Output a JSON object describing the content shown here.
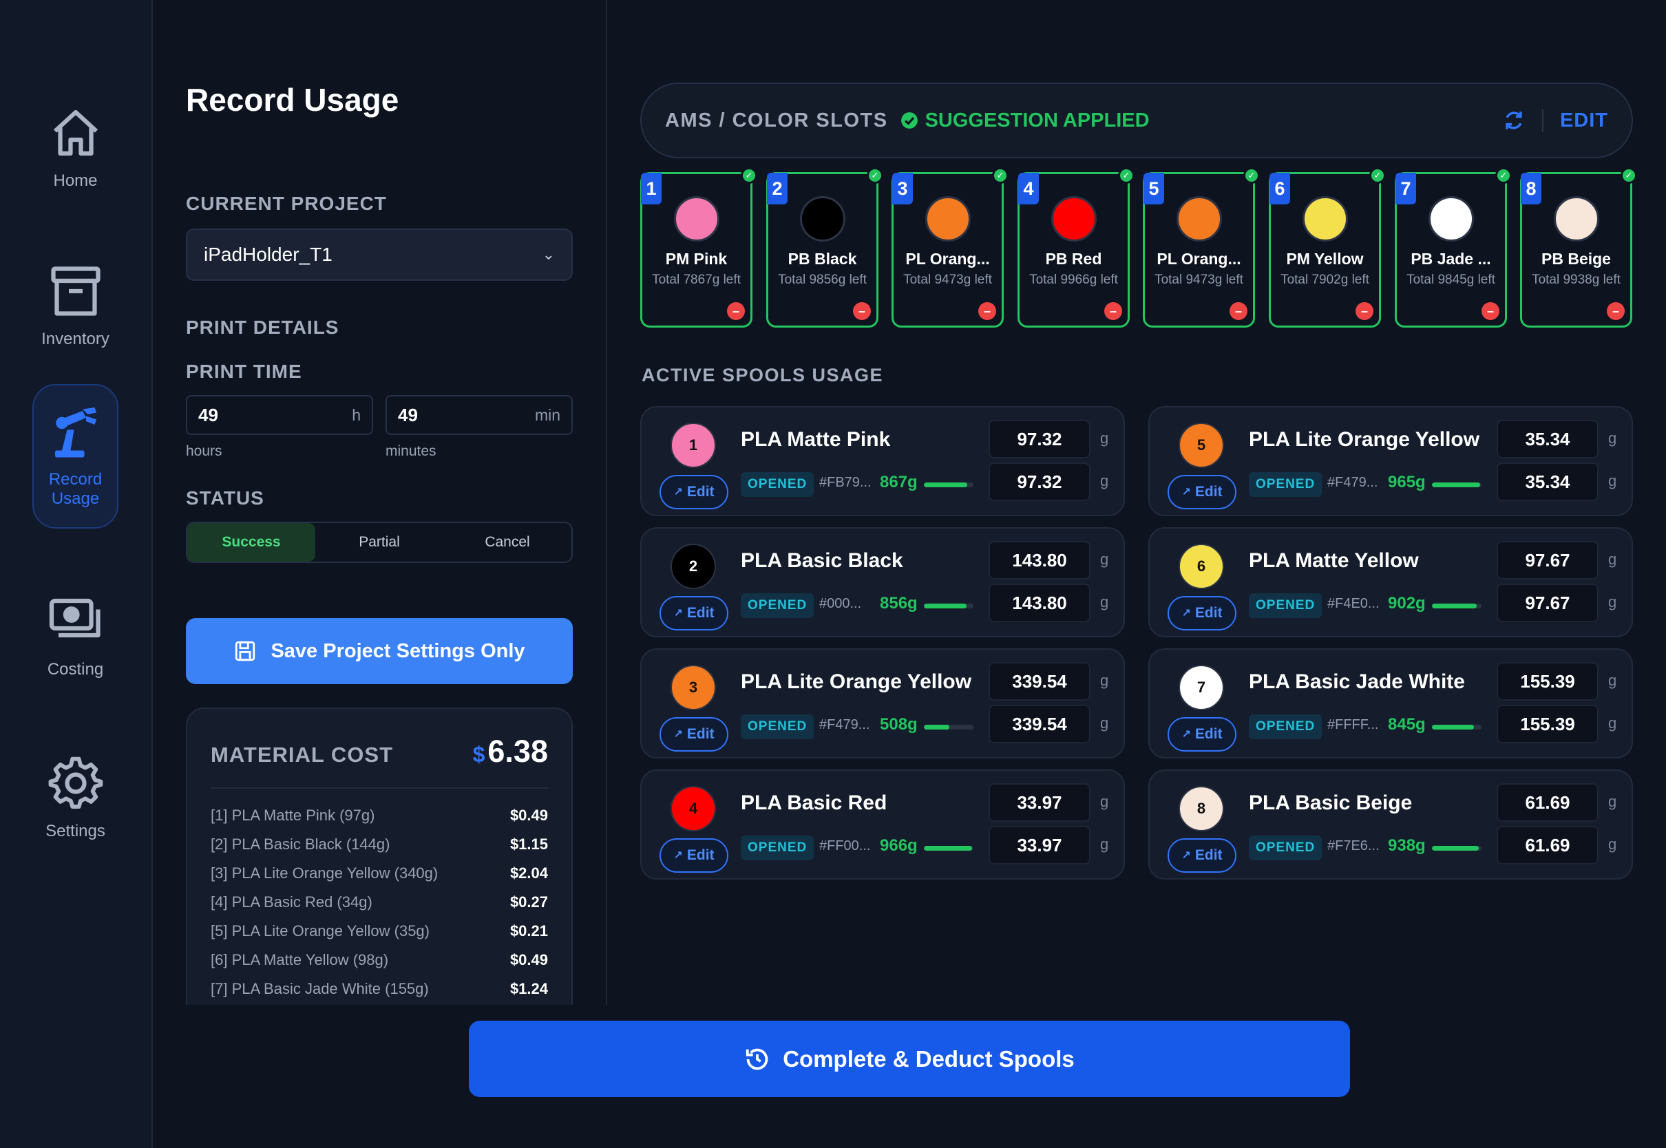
{
  "nav": [
    {
      "label": "Home",
      "icon": "home-icon"
    },
    {
      "label": "Inventory",
      "icon": "archive-icon"
    },
    {
      "label": "Record\nUsage",
      "icon": "robot-arm-icon",
      "active": true
    },
    {
      "label": "Costing",
      "icon": "money-icon"
    },
    {
      "label": "Settings",
      "icon": "gear-icon"
    }
  ],
  "page": {
    "title": "Record Usage"
  },
  "project": {
    "label": "CURRENT PROJECT",
    "value": "iPadHolder_T1"
  },
  "print_details": {
    "label": "PRINT DETAILS",
    "time_label": "PRINT TIME",
    "hours": {
      "value": "49",
      "unit": "h",
      "caption": "hours"
    },
    "minutes": {
      "value": "49",
      "unit": "min",
      "caption": "minutes"
    }
  },
  "status": {
    "label": "STATUS",
    "options": [
      "Success",
      "Partial",
      "Cancel"
    ],
    "selected": "Success"
  },
  "save_button": "Save Project Settings Only",
  "material_cost": {
    "title": "MATERIAL COST",
    "currency": "$",
    "total": "6.38",
    "items": [
      {
        "label": "[1] PLA Matte Pink (97g)",
        "amount": "$0.49"
      },
      {
        "label": "[2] PLA Basic Black (144g)",
        "amount": "$1.15"
      },
      {
        "label": "[3] PLA Lite Orange Yellow (340g)",
        "amount": "$2.04"
      },
      {
        "label": "[4] PLA Basic Red (34g)",
        "amount": "$0.27"
      },
      {
        "label": "[5] PLA Lite Orange Yellow (35g)",
        "amount": "$0.21"
      },
      {
        "label": "[6] PLA Matte Yellow (98g)",
        "amount": "$0.49"
      },
      {
        "label": "[7] PLA Basic Jade White (155g)",
        "amount": "$1.24"
      }
    ]
  },
  "ams": {
    "title": "AMS / COLOR SLOTS",
    "status": "SUGGESTION APPLIED",
    "edit": "EDIT",
    "slots": [
      {
        "num": "1",
        "name": "PM Pink",
        "remaining": "Total 7867g left",
        "color": "#f47ab0"
      },
      {
        "num": "2",
        "name": "PB Black",
        "remaining": "Total 9856g left",
        "color": "#000000"
      },
      {
        "num": "3",
        "name": "PL Orang...",
        "remaining": "Total 9473g left",
        "color": "#f47b20"
      },
      {
        "num": "4",
        "name": "PB Red",
        "remaining": "Total 9966g left",
        "color": "#ff0000"
      },
      {
        "num": "5",
        "name": "PL Orang...",
        "remaining": "Total 9473g left",
        "color": "#f47b20"
      },
      {
        "num": "6",
        "name": "PM Yellow",
        "remaining": "Total 7902g left",
        "color": "#f4e04d"
      },
      {
        "num": "7",
        "name": "PB Jade ...",
        "remaining": "Total 9845g left",
        "color": "#ffffff"
      },
      {
        "num": "8",
        "name": "PB Beige",
        "remaining": "Total 9938g left",
        "color": "#f7e6da"
      }
    ]
  },
  "active_spools": {
    "title": "ACTIVE SPOOLS USAGE",
    "edit_label": "Edit",
    "badge": "OPENED",
    "unit": "g",
    "items": [
      {
        "num": "1",
        "name": "PLA Matte Pink",
        "hex": "#FB79...",
        "remaining": "867g",
        "fill": 0.87,
        "used": "97.32",
        "deduct": "97.32",
        "color": "#f47ab0",
        "dark": false
      },
      {
        "num": "2",
        "name": "PLA Basic Black",
        "hex": "#000...",
        "remaining": "856g",
        "fill": 0.86,
        "used": "143.80",
        "deduct": "143.80",
        "color": "#000000",
        "dark": true
      },
      {
        "num": "3",
        "name": "PLA Lite Orange Yellow",
        "hex": "#F479...",
        "remaining": "508g",
        "fill": 0.51,
        "used": "339.54",
        "deduct": "339.54",
        "color": "#f47b20",
        "dark": false
      },
      {
        "num": "4",
        "name": "PLA Basic Red",
        "hex": "#FF00...",
        "remaining": "966g",
        "fill": 0.97,
        "used": "33.97",
        "deduct": "33.97",
        "color": "#ff0000",
        "dark": false
      },
      {
        "num": "5",
        "name": "PLA Lite Orange Yellow",
        "hex": "#F479...",
        "remaining": "965g",
        "fill": 0.97,
        "used": "35.34",
        "deduct": "35.34",
        "color": "#f47b20",
        "dark": false
      },
      {
        "num": "6",
        "name": "PLA Matte Yellow",
        "hex": "#F4E0...",
        "remaining": "902g",
        "fill": 0.9,
        "used": "97.67",
        "deduct": "97.67",
        "color": "#f4e04d",
        "dark": false
      },
      {
        "num": "7",
        "name": "PLA Basic Jade White",
        "hex": "#FFFF...",
        "remaining": "845g",
        "fill": 0.85,
        "used": "155.39",
        "deduct": "155.39",
        "color": "#ffffff",
        "dark": false
      },
      {
        "num": "8",
        "name": "PLA Basic Beige",
        "hex": "#F7E6...",
        "remaining": "938g",
        "fill": 0.94,
        "used": "61.69",
        "deduct": "61.69",
        "color": "#f7e6da",
        "dark": false
      }
    ]
  },
  "complete_button": "Complete & Deduct Spools"
}
